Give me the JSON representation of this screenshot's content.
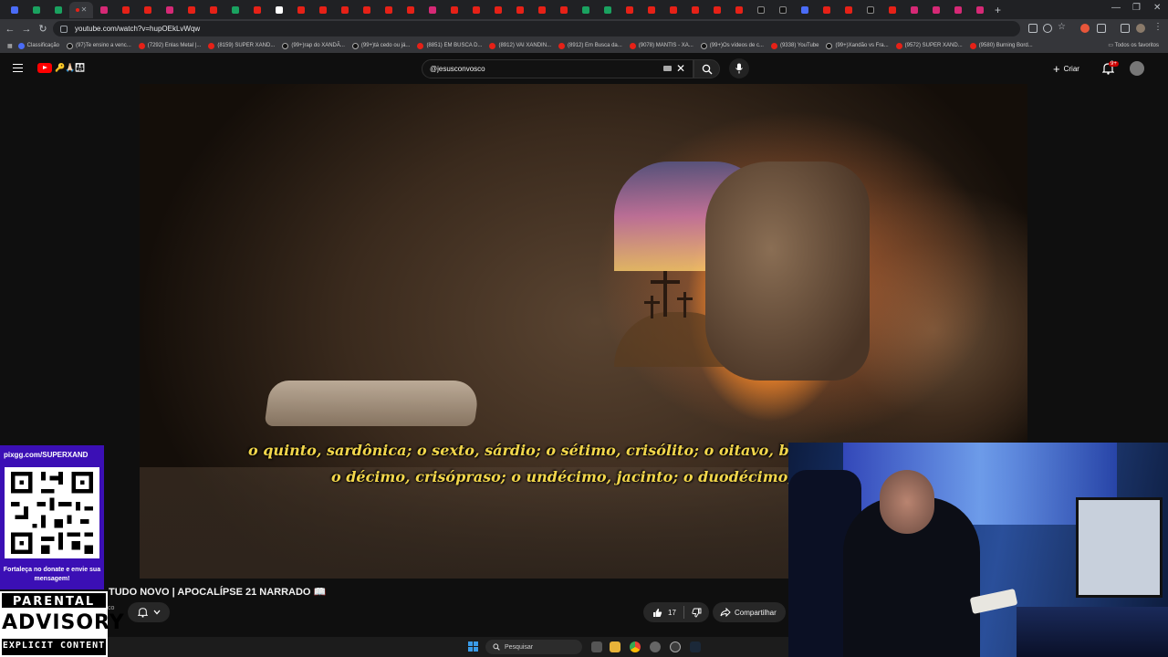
{
  "browser": {
    "url": "youtube.com/watch?v=hupOEkLvWqw",
    "bookmarks": [
      "Classificação",
      "(97)Te ensino a venc...",
      "(7292) Enlas Metal |...",
      "(8159) SUPER XAND...",
      "(99+)rap do XANDÃ...",
      "(99+)tá cedo ou já...",
      "(8851) EM BUSCA D...",
      "(8912) VAI XANDIN...",
      "(8912) Em Busca da...",
      "(9078) MANTIS - XA...",
      "(99+)Os vídeos de c...",
      "(9338) YouTube",
      "(99+)Xandão vs Fra...",
      "(9572) SUPER XAND...",
      "(9580) Burning Bord..."
    ],
    "all_favorites": "Todos os favoritos",
    "new_tab": "+"
  },
  "youtube": {
    "emoji_strip": "🔑🙏🏻👨‍👩‍👧",
    "search_value": "@jesusconvosco",
    "create_label": "Criar",
    "notif_badge": "9+"
  },
  "video": {
    "subtitle_line1": "o quinto, sardônica; o sexto, sárdio; o sétimo, crisólito; o oitavo, berilo;",
    "subtitle_line2": "o décimo, crisópraso; o undécimo, jacinto; o duodécimo, ame",
    "title": "TUDO NOVO | APOCALÍPSE 21 NARRADO 📖",
    "channel_fragment": "co",
    "likes": "17",
    "share_label": "Compartilhar"
  },
  "overlay": {
    "pix_url": "pixgg.com/SUPERXAND",
    "pix_message": "Fortaleça no donate e envie sua mensagem!",
    "advisory_top": "PARENTAL",
    "advisory_mid": "ADVISORY",
    "advisory_bottom": "EXPLICIT CONTENT"
  },
  "taskbar": {
    "search_label": "Pesquisar"
  },
  "colors": {
    "youtube_red": "#ff0000",
    "pix_purple": "#3b0fb5",
    "subtitle_yellow": "#f2d64b",
    "page_bg": "#0f0f0f"
  }
}
